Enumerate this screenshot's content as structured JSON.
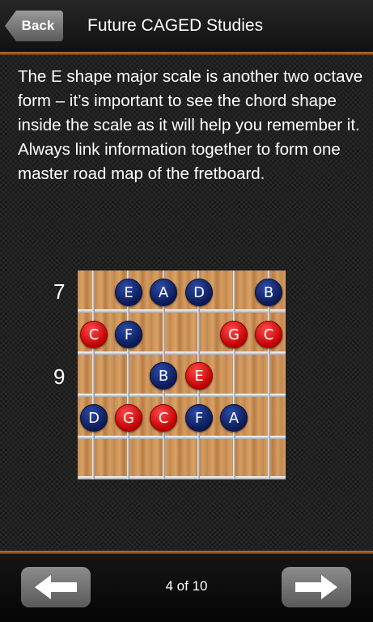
{
  "header": {
    "back_label": "Back",
    "title": "Future CAGED Studies"
  },
  "main": {
    "description": "The E shape major scale is another two octave form – it’s important to see the chord shape inside the scale as it will help you remember it. Always link information together to form one master road map of the fretboard.",
    "fret_labels": [
      "7",
      "9"
    ],
    "notes": [
      {
        "name": "E",
        "color": "blue"
      },
      {
        "name": "A",
        "color": "blue"
      },
      {
        "name": "D",
        "color": "blue"
      },
      {
        "name": "B",
        "color": "blue"
      },
      {
        "name": "C",
        "color": "red"
      },
      {
        "name": "F",
        "color": "blue"
      },
      {
        "name": "G",
        "color": "red"
      },
      {
        "name": "C",
        "color": "red"
      },
      {
        "name": "B",
        "color": "blue"
      },
      {
        "name": "E",
        "color": "red"
      },
      {
        "name": "D",
        "color": "blue"
      },
      {
        "name": "G",
        "color": "red"
      },
      {
        "name": "C",
        "color": "red"
      },
      {
        "name": "F",
        "color": "blue"
      },
      {
        "name": "A",
        "color": "blue"
      }
    ]
  },
  "footer": {
    "prev_icon": "arrow-left-icon",
    "next_icon": "arrow-right-icon",
    "page_indicator": "4 of 10"
  },
  "colors": {
    "accent_border": "#b8743c",
    "note_blue": "#0b1a55",
    "note_red": "#e01010"
  }
}
